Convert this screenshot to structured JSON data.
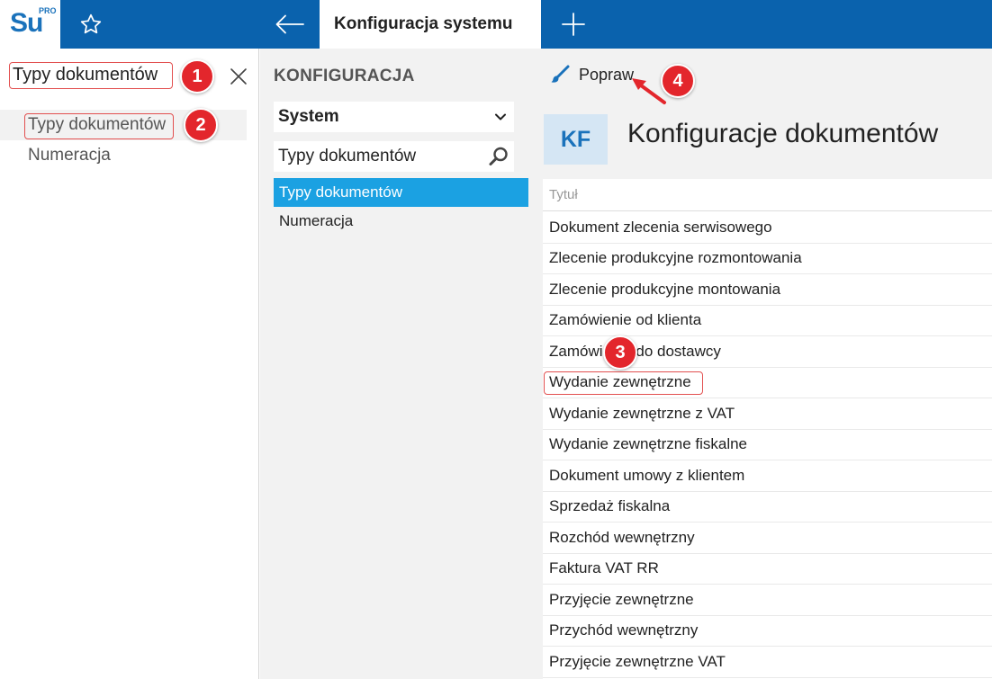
{
  "app": {
    "logo_text": "Su",
    "logo_sup": "PRO",
    "active_tab": "Konfiguracja systemu"
  },
  "left": {
    "search_value": "Typy dokumentów",
    "items": [
      {
        "label": "Typy dokumentów",
        "selected": true
      },
      {
        "label": "Numeracja",
        "selected": false
      }
    ]
  },
  "middle": {
    "title": "KONFIGURACJA",
    "select_value": "System",
    "search_value": "Typy dokumentów",
    "items": [
      {
        "label": "Typy dokumentów",
        "active": true
      },
      {
        "label": "Numeracja",
        "active": false
      }
    ]
  },
  "right": {
    "edit_label": "Popraw",
    "badge": "KF",
    "title": "Konfiguracje dokumentów",
    "column_header": "Tytuł",
    "rows": [
      "Dokument zlecenia serwisowego",
      "Zlecenie produkcyjne rozmontowania",
      "Zlecenie produkcyjne montowania",
      "Zamówienie od klienta",
      "Zamówienie do dostawcy",
      "Wydanie zewnętrzne",
      "Wydanie zewnętrzne z VAT",
      "Wydanie zewnętrzne fiskalne",
      "Dokument umowy z klientem",
      "Sprzedaż fiskalna",
      "Rozchód wewnętrzny",
      "Faktura VAT RR",
      "Przyjęcie zewnętrzne",
      "Przychód wewnętrzny",
      "Przyjęcie zewnętrzne VAT"
    ]
  },
  "markers": [
    "1",
    "2",
    "3",
    "4"
  ],
  "colors": {
    "topbar": "#0a62ad",
    "accent": "#1ba1e2",
    "marker": "#e3262c"
  }
}
